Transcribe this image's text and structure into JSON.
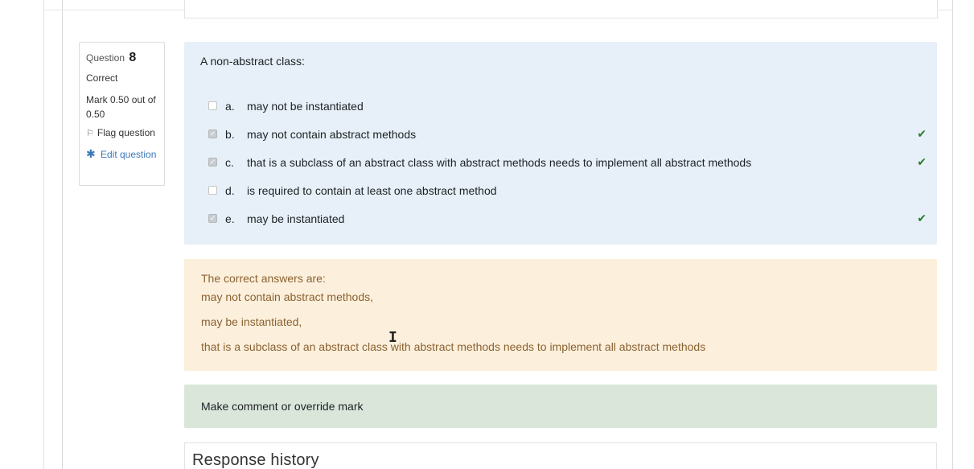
{
  "question_info": {
    "label": "Question",
    "number": "8",
    "state": "Correct",
    "grade": "Mark 0.50 out of 0.50",
    "flag_label": "Flag question",
    "edit_label": "Edit question"
  },
  "question": {
    "text": "A non-abstract class:",
    "answers": [
      {
        "letter": "a.",
        "text": "may not be instantiated",
        "checked": false,
        "correct_mark": false
      },
      {
        "letter": "b.",
        "text": "may not contain abstract methods",
        "checked": true,
        "correct_mark": true
      },
      {
        "letter": "c.",
        "text": "that is a subclass of an abstract class with abstract methods needs to implement all abstract methods",
        "checked": true,
        "correct_mark": true
      },
      {
        "letter": "d.",
        "text": "is required to contain at least one abstract method",
        "checked": false,
        "correct_mark": false
      },
      {
        "letter": "e.",
        "text": "may be instantiated",
        "checked": true,
        "correct_mark": true
      }
    ]
  },
  "feedback": {
    "heading": "The correct answers are:",
    "lines": [
      "may not contain abstract methods,",
      "may be instantiated,",
      "that is a subclass of an abstract class with abstract methods needs to implement all abstract methods"
    ]
  },
  "comment": {
    "link": "Make comment or override mark"
  },
  "history": {
    "title": "Response history"
  },
  "colors": {
    "formulation_bg": "#e7f0f8",
    "feedback_bg": "#fcefdc",
    "comment_bg": "#dbe6db",
    "tick": "#2d7a2d",
    "link": "#3a78b8"
  }
}
